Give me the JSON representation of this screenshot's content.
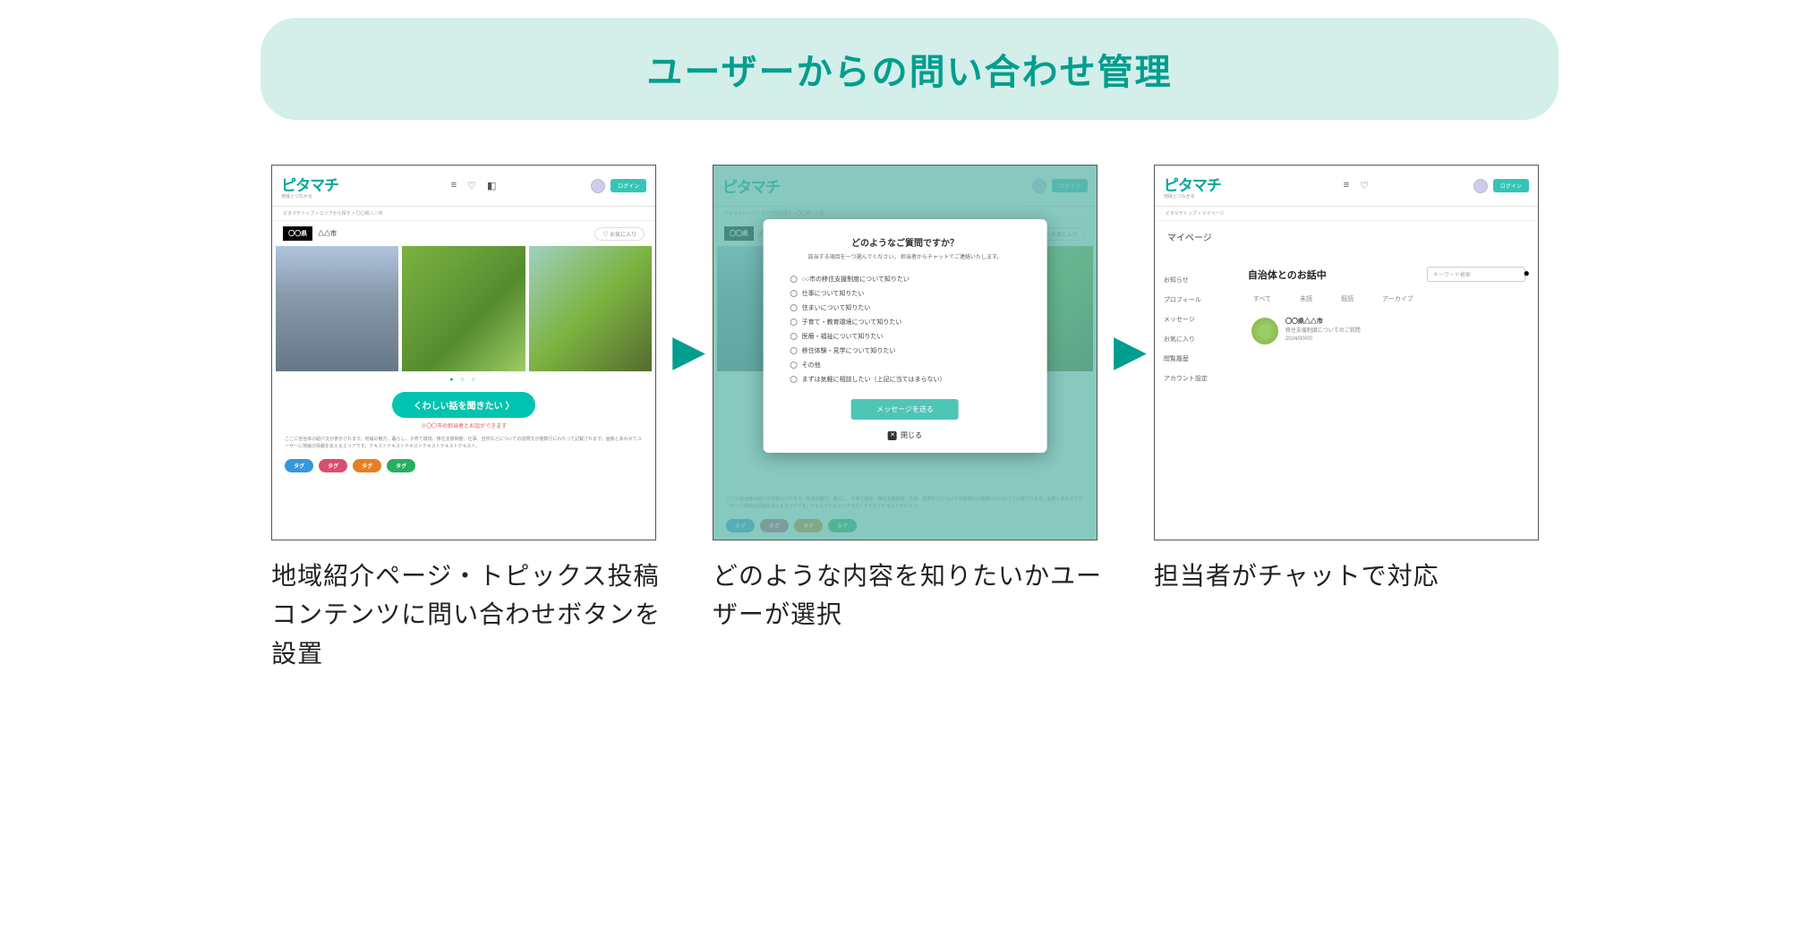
{
  "header": {
    "title": "ユーザーからの問い合わせ管理"
  },
  "steps": [
    {
      "caption": "地域紹介ページ・トピックス投稿コンテンツに問い合わせボタンを設置"
    },
    {
      "caption": "どのような内容を知りたいかユーザーが選択"
    },
    {
      "caption": "担当者がチャットで対応"
    }
  ],
  "mockup_shared": {
    "logo_text": "ピタマチ",
    "login_button": "ログイン",
    "breadcrumb": "ピタマチトップ > エリアから探す > 〇〇県△△市"
  },
  "mockup_a": {
    "region_tag": "〇〇県",
    "region_name": "△△市",
    "like_button": "♡ お気に入り",
    "pager": "● ○ ○",
    "cta": "くわしい話を聞きたい 〉",
    "cta_sub": "※〇〇市の担当者とお話ができます",
    "body_dummy": "ここに自治体の紹介文が表示されます。地域の魅力、暮らし、子育て環境、移住支援制度、仕事、自然などについての説明文が複数行にわたって記載されます。画像とあわせてユーザーに地域の情報を伝えるエリアです。テキストテキストテキストテキストテキストテキスト。",
    "tags": {
      "blue": "タグ",
      "pink": "タグ",
      "orange": "タグ",
      "green": "タグ"
    }
  },
  "mockup_b": {
    "modal": {
      "title": "どのようなご質問ですか？",
      "sub": "該当する項目を一つ選んでください。\n担当者からチャットでご連絡いたします。",
      "options": [
        "○○市の移住支援制度について知りたい",
        "仕事について知りたい",
        "住まいについて知りたい",
        "子育て・教育環境について知りたい",
        "医療・福祉について知りたい",
        "移住体験・見学について知りたい",
        "その他",
        "まずは気軽に相談したい（上記に当てはまらない）"
      ],
      "send": "メッセージを送る",
      "close": "閉じる"
    }
  },
  "mockup_c": {
    "page_title": "マイページ",
    "sidebar": {
      "items": [
        "お知らせ",
        "プロフィール",
        "メッセージ",
        "お気に入り",
        "閲覧履歴",
        "アカウント設定"
      ]
    },
    "section_title": "自治体とのお話中",
    "search_placeholder": "キーワード検索",
    "tabs": [
      "すべて",
      "未読",
      "既読",
      "アーカイブ"
    ],
    "thread": {
      "name": "〇〇県△△市",
      "line1": "移住支援制度についてのご質問",
      "line2": "2024/00/00"
    }
  }
}
